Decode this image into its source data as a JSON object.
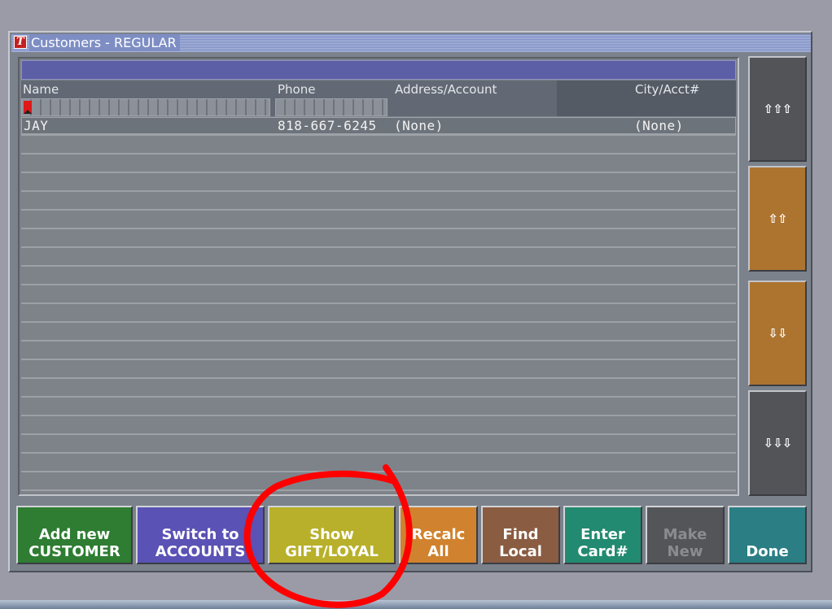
{
  "window": {
    "title": "Customers - REGULAR"
  },
  "columns": {
    "name": "Name",
    "phone": "Phone",
    "address": "Address/Account",
    "city": "City/Acct#"
  },
  "rows": [
    {
      "name": "JAY",
      "phone": "818-667-6245",
      "address": "(None)",
      "city": "(None)"
    }
  ],
  "scroll": {
    "page_up": "⇧⇧⇧",
    "up": "⇧⇧",
    "down": "⇩⇩",
    "page_down": "⇩⇩⇩"
  },
  "buttons": [
    {
      "line1": "Add new",
      "line2": "CUSTOMER",
      "color": "#2e7d32"
    },
    {
      "line1": "Switch to",
      "line2": "ACCOUNTS",
      "color": "#5a52b4"
    },
    {
      "line1": "Show",
      "line2": "GIFT/LOYAL",
      "color": "#b8b02a"
    },
    {
      "line1": "Recalc",
      "line2": "All",
      "color": "#d0822e"
    },
    {
      "line1": "Find",
      "line2": "Local",
      "color": "#8a5c42"
    },
    {
      "line1": "Enter",
      "line2": "Card#",
      "color": "#228a70"
    },
    {
      "line1": "Make",
      "line2": "New",
      "color": "#545558"
    },
    {
      "line1": "",
      "line2": "Done",
      "color": "#2a7e84"
    }
  ],
  "colors": {
    "annotation_circle": "#ff0000"
  }
}
